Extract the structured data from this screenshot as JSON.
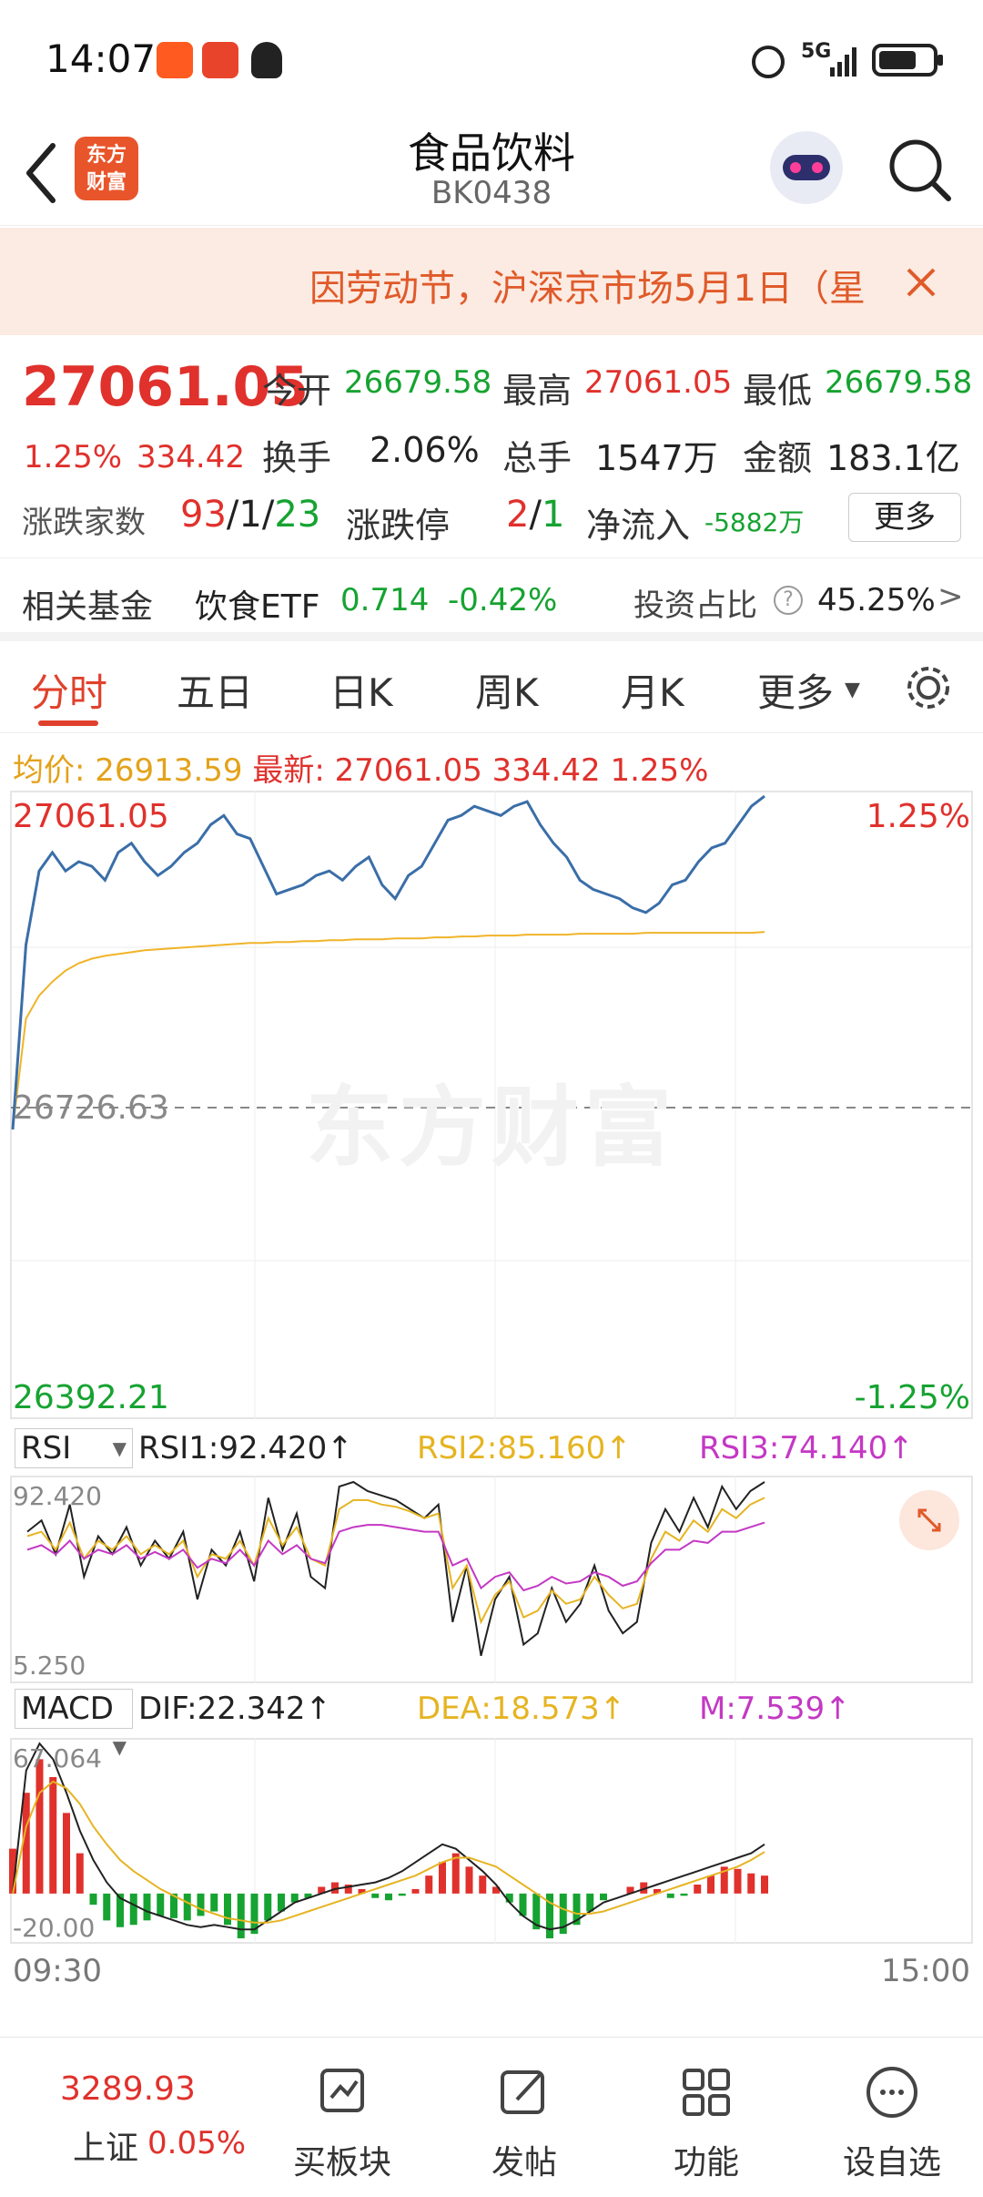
{
  "status_bar": {
    "time": "14:07",
    "network": "5G"
  },
  "nav": {
    "title": "食品饮料",
    "code": "BK0438",
    "logo_text": "东方财富"
  },
  "notice": {
    "text": "因劳动节，沪深京市场5月1日（星"
  },
  "quote": {
    "price": "27061.05",
    "change_pct": "1.25%",
    "change": "334.42",
    "open_label": "今开",
    "open": "26679.58",
    "high_label": "最高",
    "high": "27061.05",
    "low_label": "最低",
    "low": "26679.58",
    "turnover_label": "换手",
    "turnover": "2.06%",
    "volume_label": "总手",
    "volume": "1547万",
    "amount_label": "金额",
    "amount": "183.1亿",
    "breadth_label": "涨跌家数",
    "up_count": "93",
    "flat_count": "1",
    "down_count": "23",
    "limit_label": "涨跌停",
    "limit_up": "2",
    "limit_down": "1",
    "inflow_label": "净流入",
    "inflow": "-5882万",
    "more_label": "更多"
  },
  "fund": {
    "label": "相关基金",
    "name": "饮食ETF",
    "price": "0.714",
    "change": "-0.42%",
    "ratio_label": "投资占比",
    "ratio": "45.25%"
  },
  "tabs": [
    "分时",
    "五日",
    "日K",
    "周K",
    "月K",
    "更多"
  ],
  "intraday": {
    "avg_label": "均价:",
    "avg": "26913.59",
    "latest_label": "最新:",
    "latest": "27061.05",
    "change": "334.42",
    "change_pct": "1.25%",
    "y_top": "27061.05",
    "y_mid": "26726.63",
    "y_bottom": "26392.21",
    "pct_top": "1.25%",
    "pct_bottom": "-1.25%",
    "watermark": "东方财富"
  },
  "rsi": {
    "selector": "RSI",
    "rsi1": "RSI1:92.420↑",
    "rsi2": "RSI2:85.160↑",
    "rsi3": "RSI3:74.140↑",
    "top": "92.420",
    "bottom": "5.250"
  },
  "macd": {
    "selector": "MACD",
    "dif": "DIF:22.342↑",
    "dea": "DEA:18.573↑",
    "m": "M:7.539↑",
    "top": "67.064",
    "bottom": "-20.00"
  },
  "time_axis": {
    "start": "09:30",
    "end": "15:00"
  },
  "colors": {
    "up": "#e0312c",
    "down": "#16a331",
    "price_line": "#3a6ea8",
    "avg_line": "#f0b429",
    "rsi2": "#e6b422",
    "rsi3": "#c438c4"
  },
  "chart_data": [
    {
      "type": "line",
      "title": "",
      "series": [
        {
          "name": "最新",
          "values": [
            26700,
            26900,
            26980,
            27000,
            26980,
            26990,
            26985,
            26970,
            27000,
            27010,
            26990,
            26975,
            26985,
            27000,
            27010,
            27030,
            27040,
            27020,
            27015,
            26985,
            26955,
            26960,
            26965,
            26975,
            26980,
            26970,
            26985,
            26995,
            26965,
            26950,
            26975,
            26985,
            27010,
            27035,
            27040,
            27050,
            27045,
            27040,
            27050,
            27055,
            27030,
            27010,
            26995,
            26970,
            26960,
            26955,
            26950,
            26940,
            26935,
            26945,
            26965,
            26970,
            26990,
            27005,
            27010,
            27030,
            27050,
            27061
          ]
        },
        {
          "name": "均价",
          "values": [
            26700,
            26820,
            26845,
            26860,
            26872,
            26880,
            26885,
            26888,
            26890,
            26892,
            26894,
            26895,
            26896,
            26897,
            26898,
            26899,
            26900,
            26901,
            26902,
            26902,
            26903,
            26903,
            26904,
            26904,
            26905,
            26905,
            26906,
            26906,
            26906,
            26907,
            26907,
            26907,
            26908,
            26908,
            26909,
            26909,
            26910,
            26910,
            26910,
            26911,
            26911,
            26911,
            26911,
            26912,
            26912,
            26912,
            26912,
            26912,
            26913,
            26913,
            26913,
            26913,
            26913,
            26913,
            26913,
            26913,
            26913,
            26914
          ]
        }
      ],
      "ylim": [
        26392.21,
        27061.05
      ]
    },
    {
      "type": "line",
      "title": "",
      "series": [
        {
          "name": "RSI1",
          "values": [
            70,
            75,
            60,
            82,
            50,
            68,
            60,
            72,
            55,
            66,
            58,
            70,
            40,
            62,
            55,
            70,
            48,
            85,
            62,
            78,
            50,
            45,
            90,
            92,
            88,
            86,
            84,
            80,
            76,
            82,
            30,
            55,
            15,
            40,
            50,
            20,
            25,
            45,
            30,
            38,
            55,
            35,
            25,
            30,
            65,
            80,
            70,
            85,
            72,
            90,
            80,
            88,
            92
          ]
        },
        {
          "name": "RSI2",
          "values": [
            68,
            70,
            62,
            74,
            58,
            66,
            62,
            68,
            60,
            64,
            60,
            66,
            50,
            60,
            58,
            66,
            55,
            76,
            64,
            72,
            58,
            55,
            80,
            84,
            84,
            82,
            81,
            79,
            76,
            78,
            45,
            55,
            30,
            42,
            48,
            32,
            35,
            44,
            38,
            40,
            50,
            42,
            36,
            38,
            58,
            70,
            66,
            75,
            70,
            80,
            76,
            82,
            85
          ]
        },
        {
          "name": "RSI3",
          "values": [
            62,
            64,
            60,
            66,
            58,
            62,
            60,
            64,
            58,
            61,
            58,
            62,
            54,
            58,
            56,
            62,
            55,
            66,
            60,
            64,
            58,
            56,
            70,
            72,
            73,
            73,
            72,
            71,
            70,
            70,
            55,
            58,
            45,
            50,
            52,
            44,
            46,
            50,
            47,
            48,
            52,
            50,
            46,
            48,
            56,
            62,
            62,
            66,
            65,
            70,
            70,
            72,
            74
          ]
        }
      ],
      "ylim": [
        5.25,
        92.42
      ]
    },
    {
      "type": "bar",
      "title": "",
      "series": [
        {
          "name": "M",
          "values": [
            20,
            45,
            60,
            52,
            36,
            18,
            -5,
            -12,
            -15,
            -14,
            -12,
            -10,
            -11,
            -12,
            -10,
            -8,
            -14,
            -20,
            -18,
            -12,
            -8,
            -4,
            -2,
            3,
            5,
            4,
            2,
            -2,
            -3,
            -1,
            2,
            8,
            14,
            18,
            12,
            8,
            3,
            -4,
            -10,
            -16,
            -20,
            -18,
            -14,
            -8,
            -3,
            0,
            3,
            5,
            2,
            -2,
            -1,
            4,
            8,
            12,
            11,
            9,
            8
          ]
        },
        {
          "name": "DIF",
          "values": [
            0,
            55,
            67,
            60,
            45,
            28,
            15,
            5,
            -2,
            -5,
            -8,
            -10,
            -12,
            -14,
            -15,
            -14,
            -15,
            -16,
            -16,
            -12,
            -8,
            -4,
            -2,
            0,
            2,
            3,
            4,
            5,
            7,
            10,
            14,
            18,
            22,
            20,
            15,
            10,
            4,
            -4,
            -10,
            -14,
            -16,
            -15,
            -12,
            -8,
            -4,
            -2,
            0,
            2,
            4,
            6,
            8,
            10,
            12,
            14,
            16,
            18,
            22
          ]
        },
        {
          "name": "DEA",
          "values": [
            0,
            30,
            45,
            50,
            47,
            40,
            30,
            22,
            15,
            10,
            6,
            2,
            -1,
            -4,
            -7,
            -9,
            -11,
            -12,
            -13,
            -13,
            -12,
            -10,
            -8,
            -6,
            -4,
            -2,
            0,
            2,
            4,
            6,
            8,
            11,
            14,
            16,
            16,
            14,
            12,
            8,
            4,
            0,
            -4,
            -7,
            -9,
            -9,
            -8,
            -6,
            -4,
            -2,
            0,
            2,
            4,
            6,
            8,
            10,
            12,
            15,
            18.573
          ]
        }
      ],
      "ylim": [
        -20,
        67.064
      ]
    }
  ]
}
